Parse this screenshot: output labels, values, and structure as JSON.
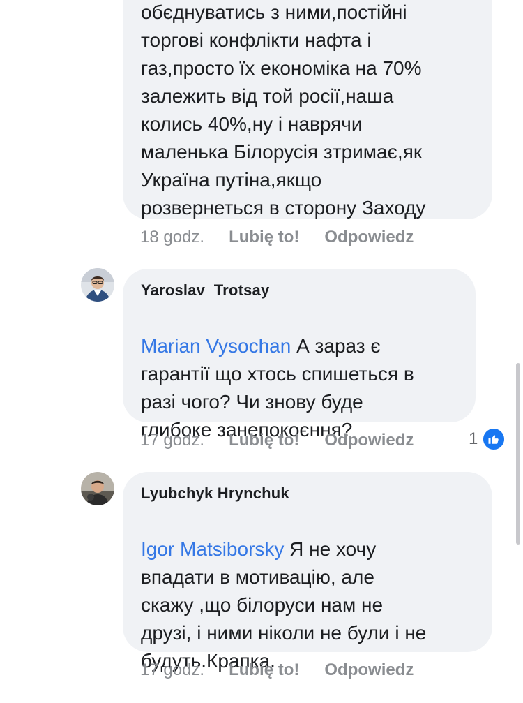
{
  "comments": [
    {
      "text": "обєднуватись з ними,постійні\nторгові конфлікти нафта і\nгаз,просто їх економіка на 70%\nзалежить від той росії,наша\nколись 40%,ну і наврячи\nмаленька Білорусія зтримає,як\nУкраїна путіна,якщо\nрозвернеться в сторону Заходу",
      "time": "18 godz.",
      "like_label": "Lubię to!",
      "reply_label": "Odpowiedz"
    },
    {
      "author": "Yaroslav  Trotsay",
      "mention": "Marian Vysochan",
      "text_first": " А зараз є",
      "text_rest": "гарантії що хтось спишеться в\nразі чого? Чи знову буде\nглибоке занепокоєння?",
      "time": "17 godz.",
      "like_label": "Lubię to!",
      "reply_label": "Odpowiedz",
      "reaction_count": "1"
    },
    {
      "author": "Lyubchyk Hrynchuk",
      "mention": "Igor Matsiborsky",
      "text_first": " Я не хочу",
      "text_rest": "впадати в мотивацію, але\nскажу ,що білоруси нам не\nдрузі, і ними ніколи не були і не\nбудуть.Крапка.",
      "time": "17 godz.",
      "like_label": "Lubię to!",
      "reply_label": "Odpowiedz"
    }
  ],
  "colors": {
    "bubble": "#f0f2f5",
    "mention": "#3578e5",
    "meta": "#8a8d91",
    "like_badge": "#1877f2"
  },
  "icons": {
    "reaction": "thumbs-up-icon"
  }
}
